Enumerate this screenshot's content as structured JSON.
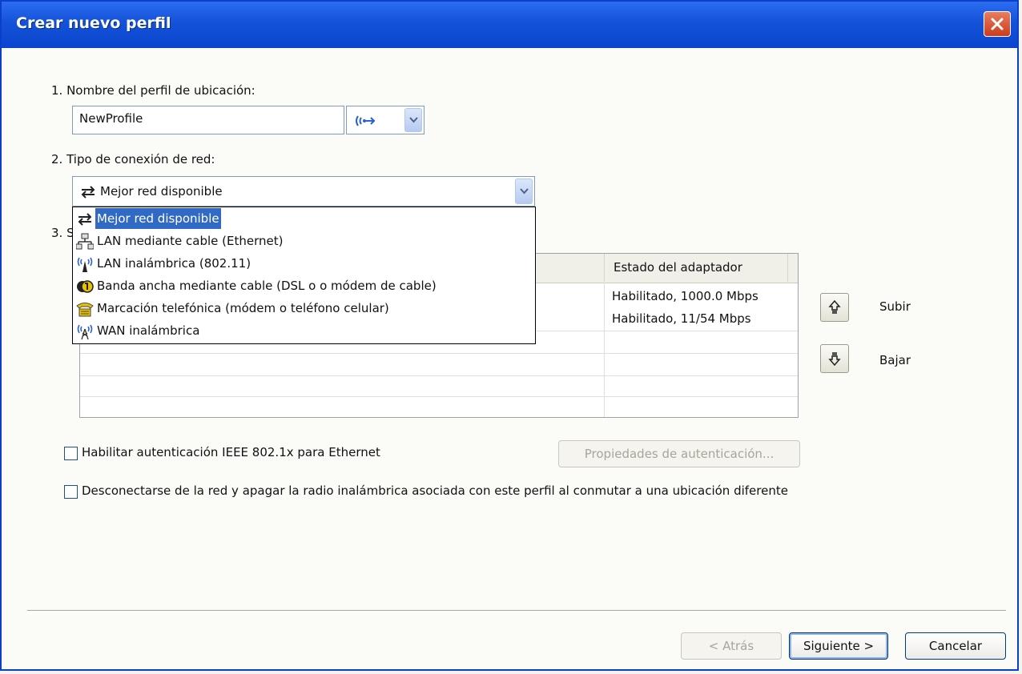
{
  "window": {
    "title": "Crear nuevo perfil"
  },
  "section1": {
    "label": "1. Nombre del perfil de ubicación:",
    "profile_name": "NewProfile",
    "icon_combo_icon": "wireless-location-icon"
  },
  "section2": {
    "label": "2. Tipo de conexión de red:",
    "selected": "Mejor red disponible",
    "options": [
      {
        "label": "Mejor red disponible",
        "icon": "best-network-icon"
      },
      {
        "label": "LAN mediante cable (Ethernet)",
        "icon": "wired-lan-icon"
      },
      {
        "label": "LAN inalámbrica (802.11)",
        "icon": "wireless-lan-icon"
      },
      {
        "label": "Banda ancha mediante cable (DSL o o módem de cable)",
        "icon": "broadband-icon"
      },
      {
        "label": "Marcación telefónica (módem o teléfono celular)",
        "icon": "dialup-phone-icon"
      },
      {
        "label": "WAN inalámbrica",
        "icon": "wireless-wan-icon"
      }
    ]
  },
  "section3": {
    "label_partial": "3. S",
    "grid": {
      "column_status": "Estado del adaptador",
      "rows": [
        {
          "status": "Habilitado, 1000.0 Mbps"
        },
        {
          "status": "Habilitado, 11/54  Mbps"
        }
      ]
    },
    "move_up_label": "Subir",
    "move_down_label": "Bajar"
  },
  "options": {
    "enable_8021x_label": "Habilitar autenticación IEEE 802.1x para Ethernet",
    "auth_properties_button": "Propiedades de autenticación...",
    "disconnect_label": "Desconectarse de la red y apagar la radio inalámbrica asociada con este perfil al conmutar a una ubicación diferente"
  },
  "footer": {
    "back_button": "< Atrás",
    "next_button": "Siguiente >",
    "cancel_button": "Cancelar"
  },
  "colors": {
    "titlebar": "#0a45cf",
    "selection": "#316ac5",
    "close_button": "#cc3b1f"
  }
}
